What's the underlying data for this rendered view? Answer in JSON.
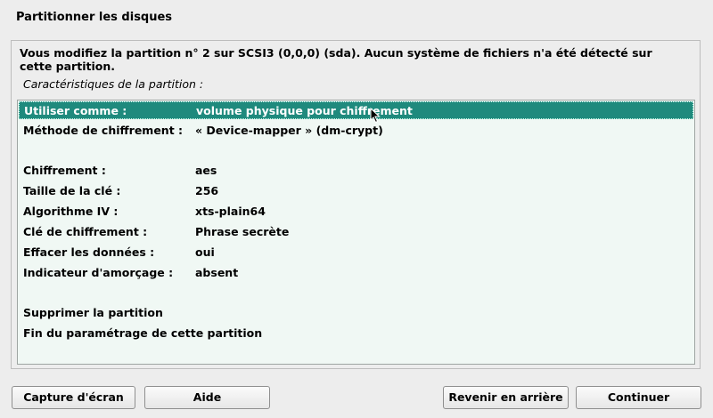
{
  "window": {
    "title": "Partitionner les disques"
  },
  "panel": {
    "description": "Vous modifiez la partition n° 2 sur SCSI3 (0,0,0) (sda). Aucun système de fichiers n'a été détecté sur cette partition.",
    "subtitle": "Caractéristiques de la partition :"
  },
  "settings": [
    {
      "key": "Utiliser comme :",
      "value": "volume physique pour chiffrement"
    },
    {
      "key": "Méthode de chiffrement :",
      "value": "« Device-mapper » (dm-crypt)"
    },
    {
      "key": "Chiffrement :",
      "value": "aes"
    },
    {
      "key": "Taille de la clé :",
      "value": "256"
    },
    {
      "key": "Algorithme IV :",
      "value": "xts-plain64"
    },
    {
      "key": "Clé de chiffrement :",
      "value": "Phrase secrète"
    },
    {
      "key": "Effacer les données :",
      "value": "oui"
    },
    {
      "key": "Indicateur d'amorçage :",
      "value": "absent"
    }
  ],
  "actions": [
    {
      "label": "Supprimer la partition"
    },
    {
      "label": "Fin du paramétrage de cette partition"
    }
  ],
  "buttons": {
    "screenshot": "Capture d'écran",
    "help": "Aide",
    "back": "Revenir en arrière",
    "continue": "Continuer"
  },
  "colors": {
    "selection": "#1f8a7d",
    "list_background": "#f0f8f4",
    "window_background": "#ededed"
  }
}
